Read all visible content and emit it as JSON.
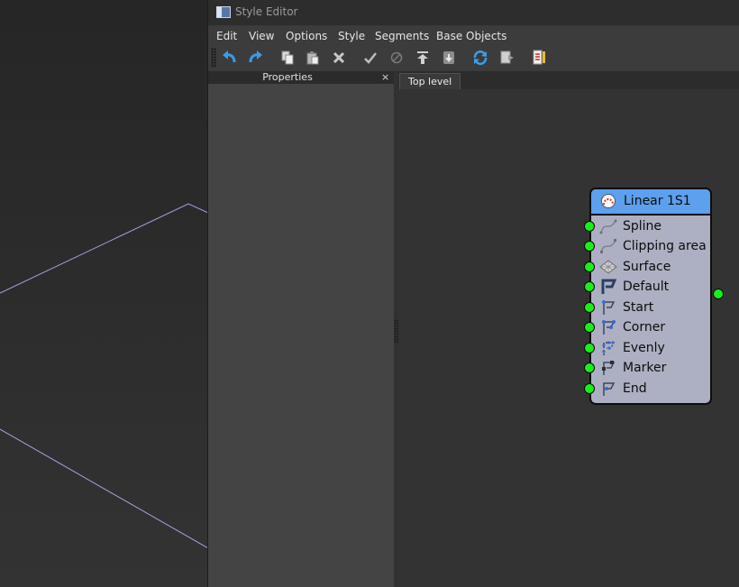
{
  "window": {
    "title": "Style Editor"
  },
  "menu": [
    "Edit",
    "View",
    "Options",
    "Style",
    "Segments",
    "Base Objects"
  ],
  "toolbar": {
    "buttons": [
      "undo-icon",
      "redo-icon",
      "copy-icon",
      "paste-icon",
      "delete-icon",
      "apply-icon",
      "disable-icon",
      "move-to-top-icon",
      "move-to-bottom-icon",
      "refresh-icon",
      "export-icon",
      "style-list-icon"
    ]
  },
  "properties_panel": {
    "title": "Properties",
    "close": "×"
  },
  "tabs": [
    "Top level"
  ],
  "node": {
    "title": "Linear 1S1",
    "header_color": "#5ca0ee",
    "body_color": "#adb0c2",
    "pin_color": "#19ef19",
    "ports": [
      {
        "label": "Spline",
        "icon": "spline-icon"
      },
      {
        "label": "Clipping area",
        "icon": "clipping-area-icon"
      },
      {
        "label": "Surface",
        "icon": "surface-icon"
      },
      {
        "label": "Default",
        "icon": "default-icon"
      },
      {
        "label": "Start",
        "icon": "start-icon"
      },
      {
        "label": "Corner",
        "icon": "corner-icon"
      },
      {
        "label": "Evenly",
        "icon": "evenly-icon"
      },
      {
        "label": "Marker",
        "icon": "marker-icon"
      },
      {
        "label": "End",
        "icon": "end-icon"
      }
    ]
  }
}
